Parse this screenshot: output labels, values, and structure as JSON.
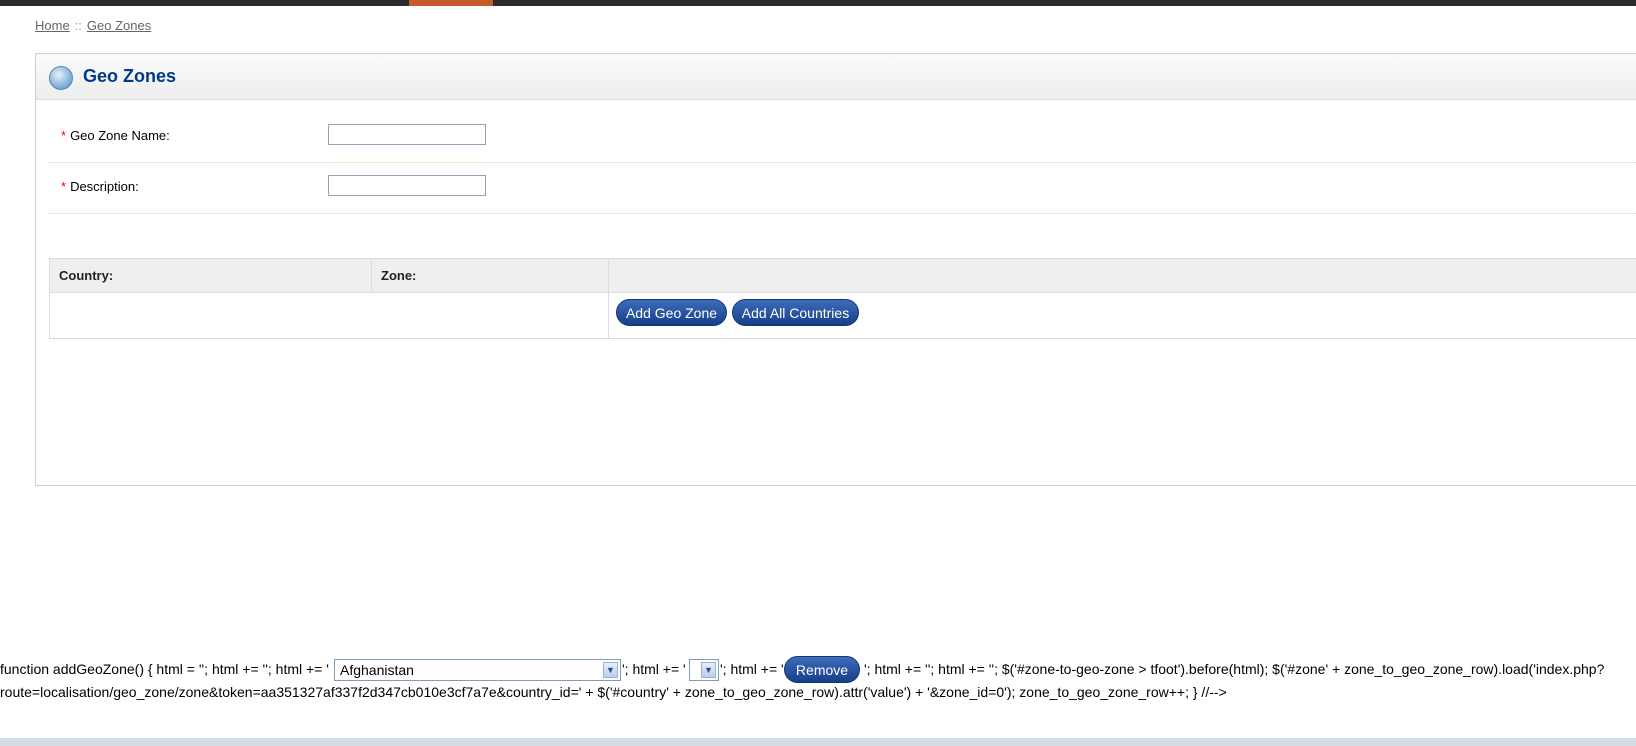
{
  "breadcrumb": {
    "home": "Home",
    "separator": "::",
    "current": "Geo Zones"
  },
  "heading": {
    "title": "Geo Zones",
    "icon": "globe-icon"
  },
  "form": {
    "name_label": "Geo Zone Name:",
    "name_value": "",
    "description_label": "Description:",
    "description_value": "",
    "required_mark": "*"
  },
  "zone_table": {
    "headers": {
      "country": "Country:",
      "zone": "Zone:"
    },
    "add_geo_zone_button": "Add Geo Zone",
    "add_all_countries_button": "Add All Countries"
  },
  "script_dump": {
    "line1_part1": "function addGeoZone() { html = ''; html += ''; html += '",
    "country_select_value": "Afghanistan",
    "line1_part2": "'; html += '",
    "line1_part3": "'; html += '",
    "remove_button": "Remove",
    "line1_part4": "'; html += ''; html += ''; $('#zone-to-geo-zone > tfoot').before(html); $('#zone' + zone_to_geo_zone_row).load('index.php?",
    "line2": "route=localisation/geo_zone/zone&token=aa351327af337f2d347cb010e3cf7a7e&country_id=' + $('#country' + zone_to_geo_zone_row).attr('value') + '&zone_id=0'); zone_to_geo_zone_row++; } //-->"
  },
  "colors": {
    "accent": "#c8592b",
    "title": "#003a88",
    "button": "#1d4a97"
  }
}
